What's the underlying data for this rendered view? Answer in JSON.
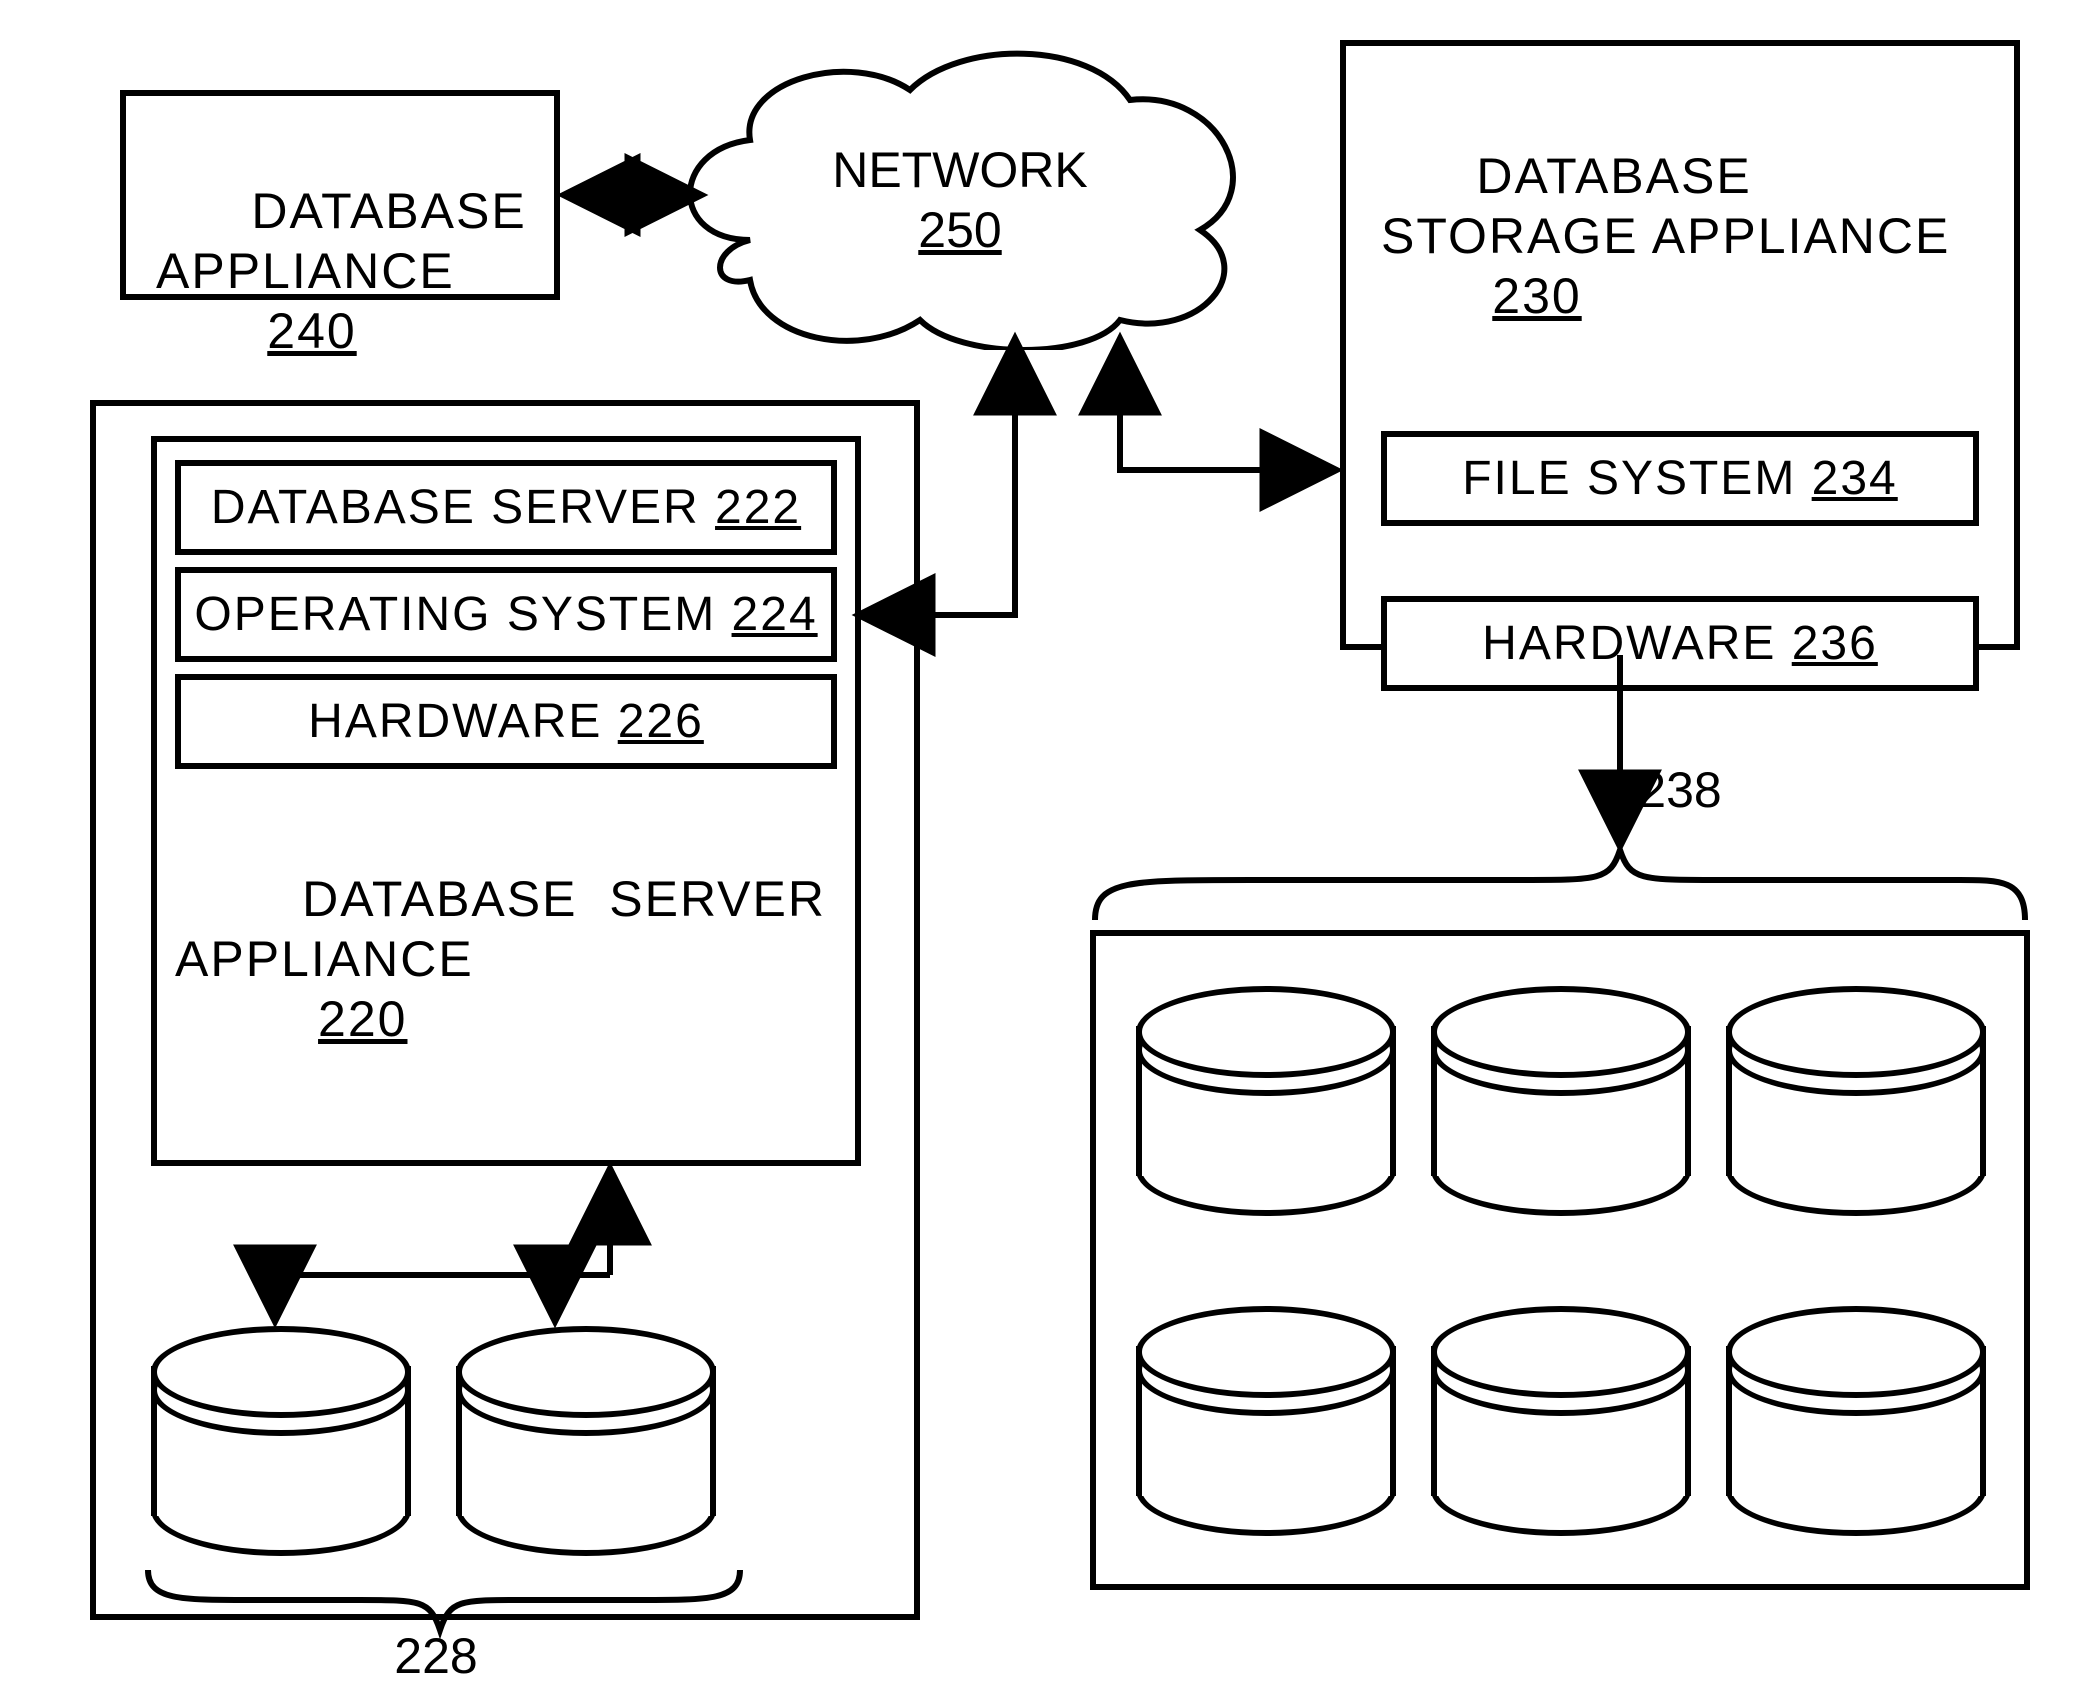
{
  "db_appliance": {
    "label": "DATABASE\nAPPLIANCE",
    "ref": "240"
  },
  "network": {
    "label": "NETWORK",
    "ref": "250"
  },
  "storage_appliance": {
    "label": "DATABASE\nSTORAGE APPLIANCE",
    "ref": "230",
    "file_system": {
      "label": "FILE SYSTEM",
      "ref": "234"
    },
    "hardware": {
      "label": "HARDWARE",
      "ref": "236"
    },
    "disks_ref": "238"
  },
  "server_appliance": {
    "label": "DATABASE  SERVER\nAPPLIANCE",
    "ref": "220",
    "db_server": {
      "label": "DATABASE SERVER",
      "ref": "222"
    },
    "os": {
      "label": "OPERATING SYSTEM",
      "ref": "224"
    },
    "hardware": {
      "label": "HARDWARE",
      "ref": "226"
    },
    "disks_ref": "228"
  }
}
